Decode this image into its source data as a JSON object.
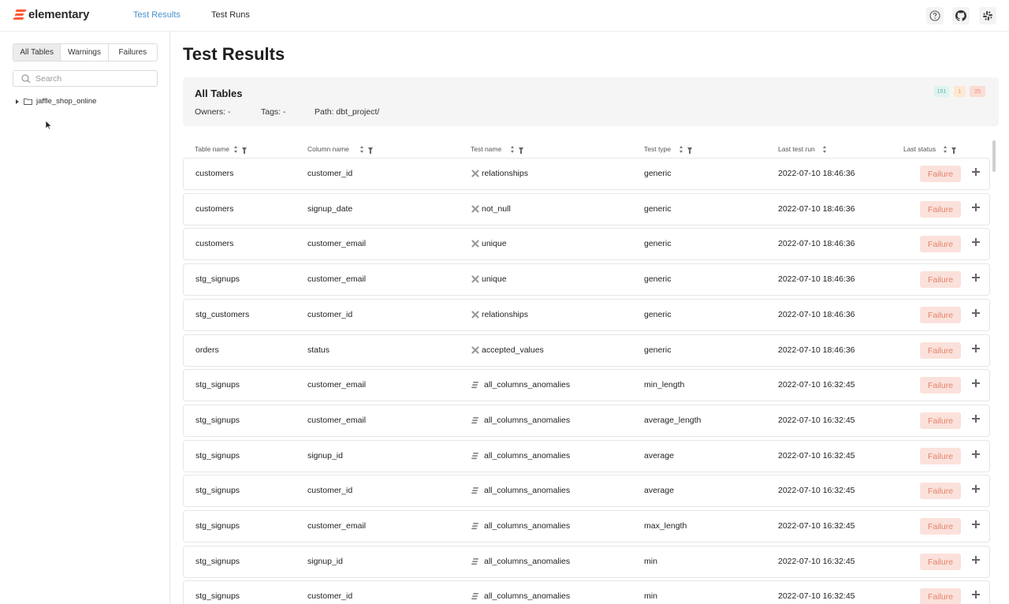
{
  "app": {
    "logo_text": "elementary",
    "brand_color": "#ff5a36",
    "nav": [
      {
        "label": "Test Results",
        "active": true
      },
      {
        "label": "Test Runs",
        "active": false
      }
    ],
    "header_icons": [
      "help-icon",
      "github-icon",
      "slack-icon"
    ]
  },
  "sidebar": {
    "tabs": [
      {
        "label": "All Tables",
        "active": true
      },
      {
        "label": "Warnings",
        "active": false
      },
      {
        "label": "Failures",
        "active": false
      }
    ],
    "search": {
      "placeholder": "Search",
      "value": ""
    },
    "tree": [
      {
        "label": "jaffle_shop_online",
        "expanded": false
      }
    ]
  },
  "main": {
    "title": "Test Results",
    "summary": {
      "title": "All Tables",
      "owners": "Owners: -",
      "tags": "Tags: -",
      "path": "Path: dbt_project/",
      "badges": [
        {
          "value": "151",
          "bg": "#dff3ef",
          "color": "#62b8a6"
        },
        {
          "value": "1",
          "bg": "#fde8d3",
          "color": "#e6a062"
        },
        {
          "value": "25",
          "bg": "#fbdcd5",
          "color": "#e58a76"
        }
      ]
    },
    "columns": [
      "Table name",
      "Column name",
      "Test name",
      "Test type",
      "Last test run",
      "Last status"
    ],
    "rows": [
      {
        "table": "customers",
        "column": "customer_id",
        "test": "relationships",
        "test_icon": "dbt-test-icon",
        "type": "generic",
        "run": "2022-07-10 18:46:36",
        "status": "Failure"
      },
      {
        "table": "customers",
        "column": "signup_date",
        "test": "not_null",
        "test_icon": "dbt-test-icon",
        "type": "generic",
        "run": "2022-07-10 18:46:36",
        "status": "Failure"
      },
      {
        "table": "customers",
        "column": "customer_email",
        "test": "unique",
        "test_icon": "dbt-test-icon",
        "type": "generic",
        "run": "2022-07-10 18:46:36",
        "status": "Failure"
      },
      {
        "table": "stg_signups",
        "column": "customer_email",
        "test": "unique",
        "test_icon": "dbt-test-icon",
        "type": "generic",
        "run": "2022-07-10 18:46:36",
        "status": "Failure"
      },
      {
        "table": "stg_customers",
        "column": "customer_id",
        "test": "relationships",
        "test_icon": "dbt-test-icon",
        "type": "generic",
        "run": "2022-07-10 18:46:36",
        "status": "Failure"
      },
      {
        "table": "orders",
        "column": "status",
        "test": "accepted_values",
        "test_icon": "dbt-test-icon",
        "type": "generic",
        "run": "2022-07-10 18:46:36",
        "status": "Failure"
      },
      {
        "table": "stg_signups",
        "column": "customer_email",
        "test": "all_columns_anomalies",
        "test_icon": "elementary-test-icon",
        "type": "min_length",
        "run": "2022-07-10 16:32:45",
        "status": "Failure"
      },
      {
        "table": "stg_signups",
        "column": "customer_email",
        "test": "all_columns_anomalies",
        "test_icon": "elementary-test-icon",
        "type": "average_length",
        "run": "2022-07-10 16:32:45",
        "status": "Failure"
      },
      {
        "table": "stg_signups",
        "column": "signup_id",
        "test": "all_columns_anomalies",
        "test_icon": "elementary-test-icon",
        "type": "average",
        "run": "2022-07-10 16:32:45",
        "status": "Failure"
      },
      {
        "table": "stg_signups",
        "column": "customer_id",
        "test": "all_columns_anomalies",
        "test_icon": "elementary-test-icon",
        "type": "average",
        "run": "2022-07-10 16:32:45",
        "status": "Failure"
      },
      {
        "table": "stg_signups",
        "column": "customer_email",
        "test": "all_columns_anomalies",
        "test_icon": "elementary-test-icon",
        "type": "max_length",
        "run": "2022-07-10 16:32:45",
        "status": "Failure"
      },
      {
        "table": "stg_signups",
        "column": "signup_id",
        "test": "all_columns_anomalies",
        "test_icon": "elementary-test-icon",
        "type": "min",
        "run": "2022-07-10 16:32:45",
        "status": "Failure"
      },
      {
        "table": "stg_signups",
        "column": "customer_id",
        "test": "all_columns_anomalies",
        "test_icon": "elementary-test-icon",
        "type": "min",
        "run": "2022-07-10 16:32:45",
        "status": "Failure"
      }
    ]
  }
}
